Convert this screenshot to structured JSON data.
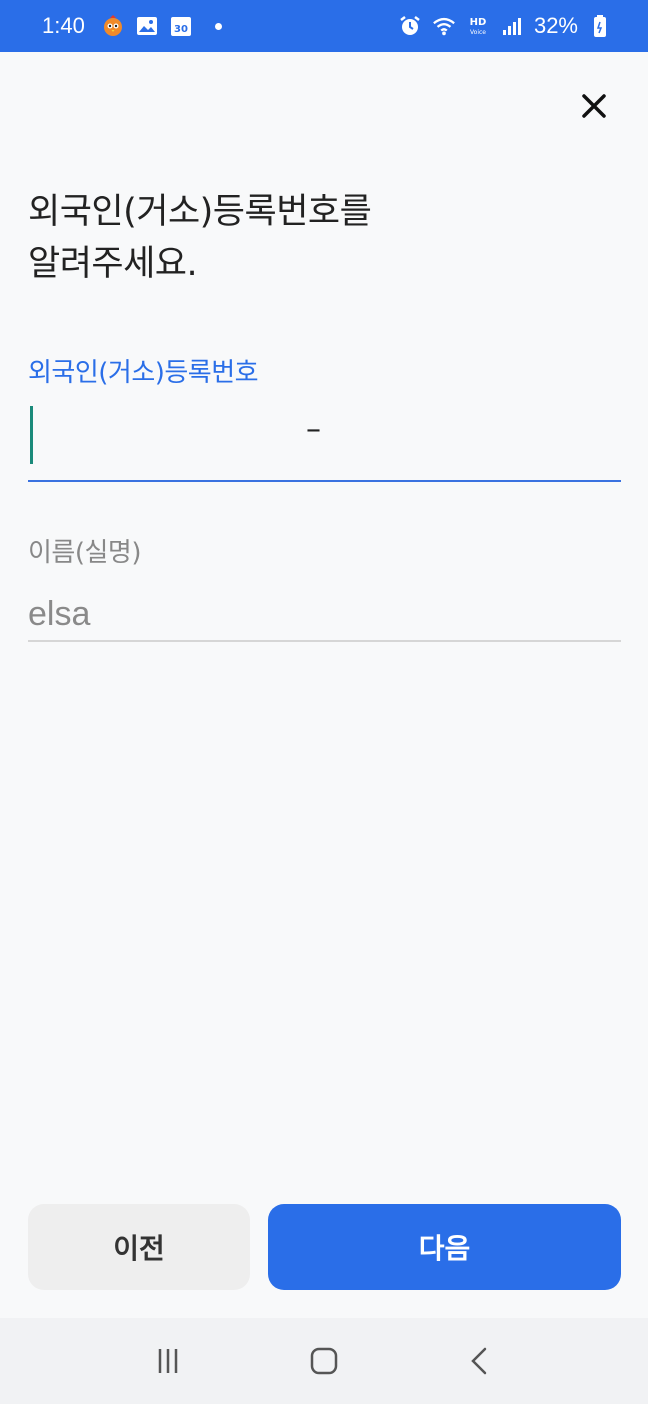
{
  "status_bar": {
    "time": "1:40",
    "battery": "32%",
    "icons": [
      "bird-app-icon",
      "gallery-icon",
      "calendar-icon",
      "alarm-icon",
      "wifi-icon",
      "hd-voice-icon",
      "signal-icon",
      "battery-icon"
    ],
    "calendar_day": "30",
    "background_color": "#2a6ee8"
  },
  "header": {
    "close_icon": "close-icon"
  },
  "title": "외국인(거소)등록번호를\n알려주세요.",
  "registration_field": {
    "label": "외국인(거소)등록번호",
    "separator": "–",
    "value": "",
    "accent_color": "#2a6ee8"
  },
  "name_field": {
    "label": "이름(실명)",
    "value": "elsa"
  },
  "buttons": {
    "prev_label": "이전",
    "next_label": "다음",
    "next_color": "#2a6ee8"
  },
  "nav_bar": {
    "icons": [
      "recent-apps-icon",
      "home-icon",
      "back-icon"
    ]
  }
}
